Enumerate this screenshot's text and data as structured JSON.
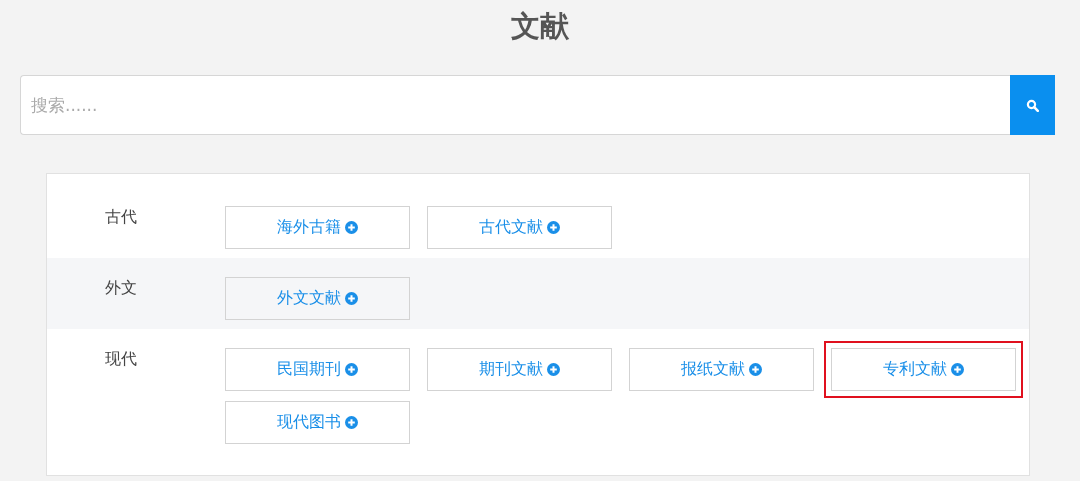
{
  "title": "文献",
  "search": {
    "placeholder": "搜索......"
  },
  "categories": [
    {
      "label": "古代",
      "items": [
        {
          "label": "海外古籍",
          "highlighted": false
        },
        {
          "label": "古代文献",
          "highlighted": false
        }
      ]
    },
    {
      "label": "外文",
      "items": [
        {
          "label": "外文文献",
          "highlighted": false
        }
      ]
    },
    {
      "label": "现代",
      "items": [
        {
          "label": "民国期刊",
          "highlighted": false
        },
        {
          "label": "期刊文献",
          "highlighted": false
        },
        {
          "label": "报纸文献",
          "highlighted": false
        },
        {
          "label": "专利文献",
          "highlighted": true
        },
        {
          "label": "现代图书",
          "highlighted": false
        }
      ]
    }
  ]
}
